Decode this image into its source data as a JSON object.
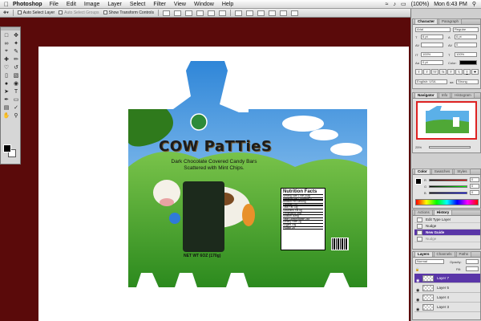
{
  "menubar": {
    "app_name": "Photoshop",
    "menus": [
      "File",
      "Edit",
      "Image",
      "Layer",
      "Select",
      "Filter",
      "View",
      "Window",
      "Help"
    ],
    "battery": "(100%)",
    "clock": "Mon 6:43 PM"
  },
  "options_bar": {
    "auto_select_layer": "Auto Select Layer",
    "auto_select_groups": "Auto Select Groups",
    "show_transform_controls": "Show Transform Controls"
  },
  "artwork": {
    "brand_name": "COW PaTTieS",
    "tagline_line1": "Dark Chocolate Covered Candy Bars",
    "tagline_line2": "Scattered with Mint Chips.",
    "net_weight": "NET WT 6OZ (170g)",
    "nutrition_title": "Nutrition Facts",
    "nutrition_rows": [
      "Serving Size 1 bar (42g)",
      "Servings Per Container 4",
      "Amount Per Serving",
      "Calories 210",
      "Total Fat 13g",
      "Saturated Fat 8g",
      "Cholesterol 5mg",
      "Sodium 30mg",
      "Total Carbohydrate 24g",
      "Dietary Fiber 2g",
      "Sugars 20g",
      "Protein 2g"
    ]
  },
  "character_panel": {
    "tabs": [
      "Character",
      "Paragraph"
    ],
    "font_family": "Arial",
    "font_style": "Regular",
    "font_size": "6 pt",
    "leading": "6 pt",
    "tracking": "0",
    "vertical_scale": "100%",
    "horizontal_scale": "100%",
    "baseline": "0 pt",
    "color_label": "Color:",
    "language": "English: USA",
    "antialias": "Strong"
  },
  "navigator_panel": {
    "tabs": [
      "Navigator",
      "Info",
      "Histogram"
    ],
    "zoom": "25%"
  },
  "color_panel": {
    "tabs": [
      "Color",
      "Swatches",
      "Styles"
    ],
    "channels": [
      "R",
      "G",
      "B"
    ],
    "values": [
      "0",
      "0",
      "0"
    ]
  },
  "history_panel": {
    "tabs": [
      "Actions",
      "History"
    ],
    "items": [
      {
        "label": "Edit Type Layer",
        "selected": false
      },
      {
        "label": "Nudge",
        "selected": false
      },
      {
        "label": "New Guide",
        "selected": true
      },
      {
        "label": "Nudge",
        "selected": false
      }
    ]
  },
  "layers_panel": {
    "tabs": [
      "Layers",
      "Channels",
      "Paths"
    ],
    "blend_mode": "Normal",
    "opacity_label": "Opacity:",
    "fill_label": "Fill:",
    "layers": [
      {
        "name": "Layer 7",
        "selected": true
      },
      {
        "name": "Layer 5",
        "selected": false
      },
      {
        "name": "Layer 4",
        "selected": false
      },
      {
        "name": "Layer 3",
        "selected": false
      }
    ]
  },
  "colors": {
    "pasteboard": "#5a0a0a",
    "selection": "#5a36a8",
    "sky": "#4fa3e6",
    "grass": "#3d9a2a"
  }
}
